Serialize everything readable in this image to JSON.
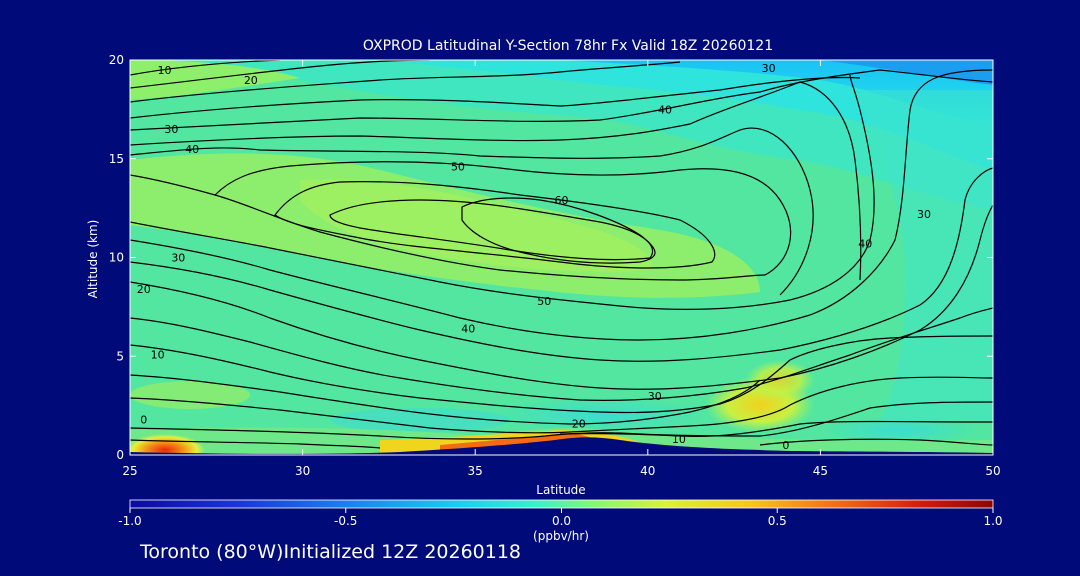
{
  "chart_data": {
    "type": "heatmap",
    "title": "OXPROD Latitudinal Y-Section 78hr  Fx Valid 18Z 20260121",
    "xlabel": "Latitude",
    "ylabel": "Altitude (km)",
    "xlim": [
      25,
      50
    ],
    "ylim": [
      0,
      20
    ],
    "x_ticks": [
      25,
      30,
      35,
      40,
      45,
      50
    ],
    "y_ticks": [
      0,
      5,
      10,
      15,
      20
    ],
    "grid": false,
    "colorbar": {
      "label": "(ppbv/hr)",
      "range": [
        -1.0,
        1.0
      ],
      "ticks": [
        "-1.0",
        "-0.5",
        "0.0",
        "0.5",
        "1.0"
      ],
      "placement": "bottom"
    },
    "contour_labels": [
      {
        "text": "10",
        "lat": 26.0,
        "alt": 19.5
      },
      {
        "text": "20",
        "lat": 28.5,
        "alt": 19.0
      },
      {
        "text": "30",
        "lat": 43.5,
        "alt": 19.6
      },
      {
        "text": "30",
        "lat": 26.2,
        "alt": 16.5
      },
      {
        "text": "40",
        "lat": 26.8,
        "alt": 15.5
      },
      {
        "text": "40",
        "lat": 40.5,
        "alt": 17.5
      },
      {
        "text": "50",
        "lat": 34.5,
        "alt": 14.6
      },
      {
        "text": "60",
        "lat": 37.5,
        "alt": 12.9
      },
      {
        "text": "30",
        "lat": 48.0,
        "alt": 12.2
      },
      {
        "text": "40",
        "lat": 46.3,
        "alt": 10.7
      },
      {
        "text": "30",
        "lat": 26.4,
        "alt": 10.0
      },
      {
        "text": "20",
        "lat": 25.4,
        "alt": 8.4
      },
      {
        "text": "50",
        "lat": 37.0,
        "alt": 7.8
      },
      {
        "text": "40",
        "lat": 34.8,
        "alt": 6.4
      },
      {
        "text": "10",
        "lat": 25.8,
        "alt": 5.1
      },
      {
        "text": "30",
        "lat": 40.2,
        "alt": 3.0
      },
      {
        "text": "0",
        "lat": 25.4,
        "alt": 1.8
      },
      {
        "text": "20",
        "lat": 38.0,
        "alt": 1.6
      },
      {
        "text": "10",
        "lat": 40.9,
        "alt": 0.8
      },
      {
        "text": "0",
        "lat": 44.0,
        "alt": 0.5
      }
    ]
  },
  "footer": {
    "location": "Toronto (80°W)",
    "initialized": "Initialized 12Z 20260118"
  },
  "colors": {
    "background": "#000a78",
    "field_base": "#4fe8a8",
    "terrain": "#000a78"
  }
}
